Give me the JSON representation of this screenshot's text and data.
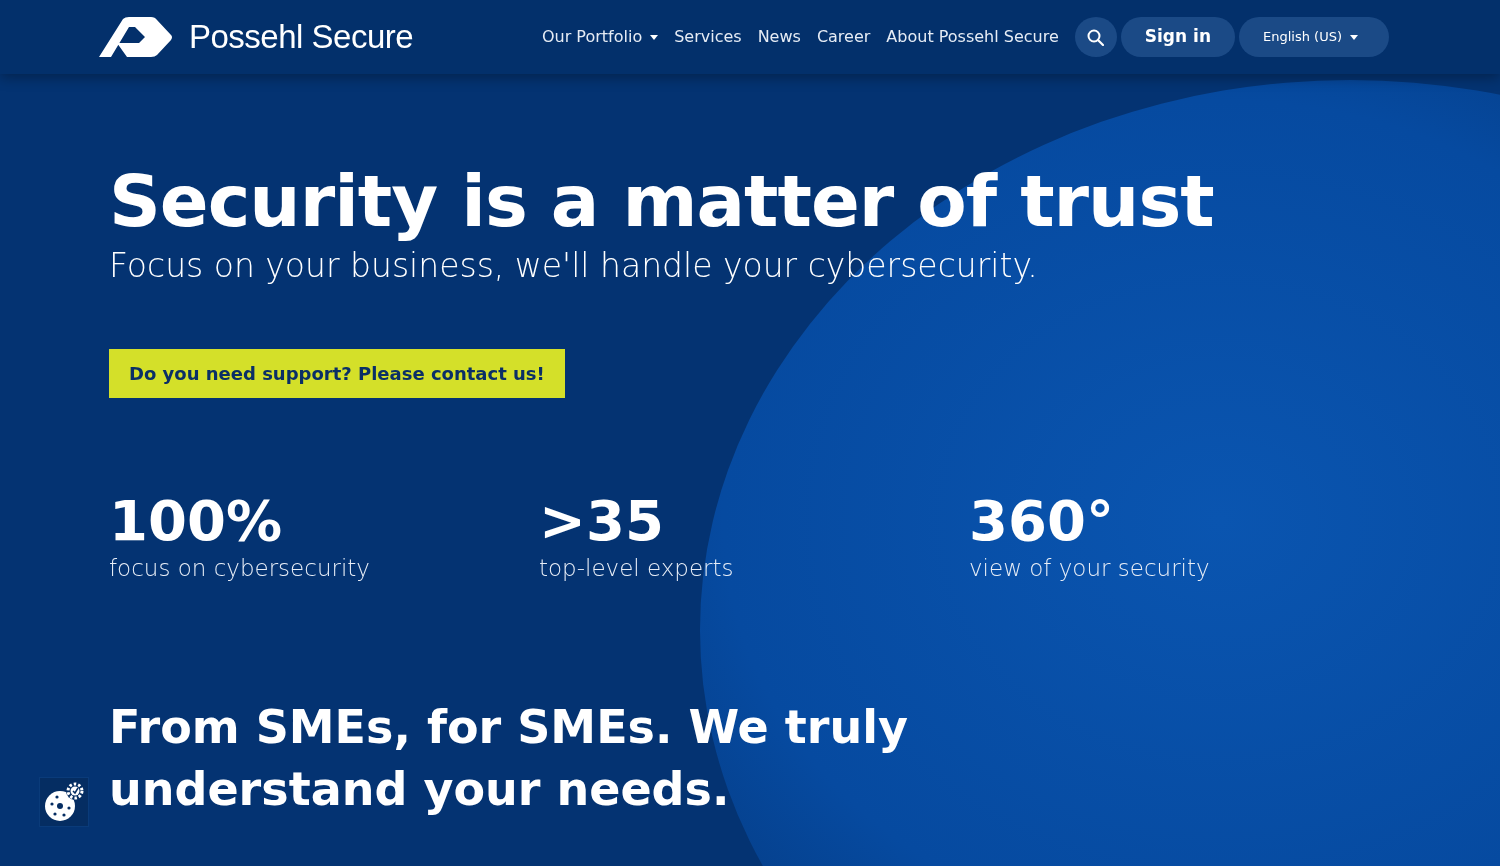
{
  "brand": {
    "name": "Possehl Secure"
  },
  "nav": [
    {
      "label": "Our Portfolio",
      "kind": "dropdown"
    },
    {
      "label": "Services",
      "kind": "link"
    },
    {
      "label": "News",
      "kind": "link"
    },
    {
      "label": "Career",
      "kind": "link"
    },
    {
      "label": "About Possehl Secure",
      "kind": "link"
    }
  ],
  "sign_in": "Sign in",
  "language": "English (US)",
  "hero": {
    "title": "Security is a matter of trust",
    "subtitle": "Focus on your business, we'll handle your cybersecurity.",
    "cta": "Do you need support? Please contact us!"
  },
  "stats": [
    {
      "value": "100%",
      "label": "focus on cybersecurity"
    },
    {
      "value": ">35",
      "label": "top-level experts"
    },
    {
      "value": "360°",
      "label": "view of your security"
    }
  ],
  "tagline": "From SMEs, for SMEs. We truly understand your needs."
}
